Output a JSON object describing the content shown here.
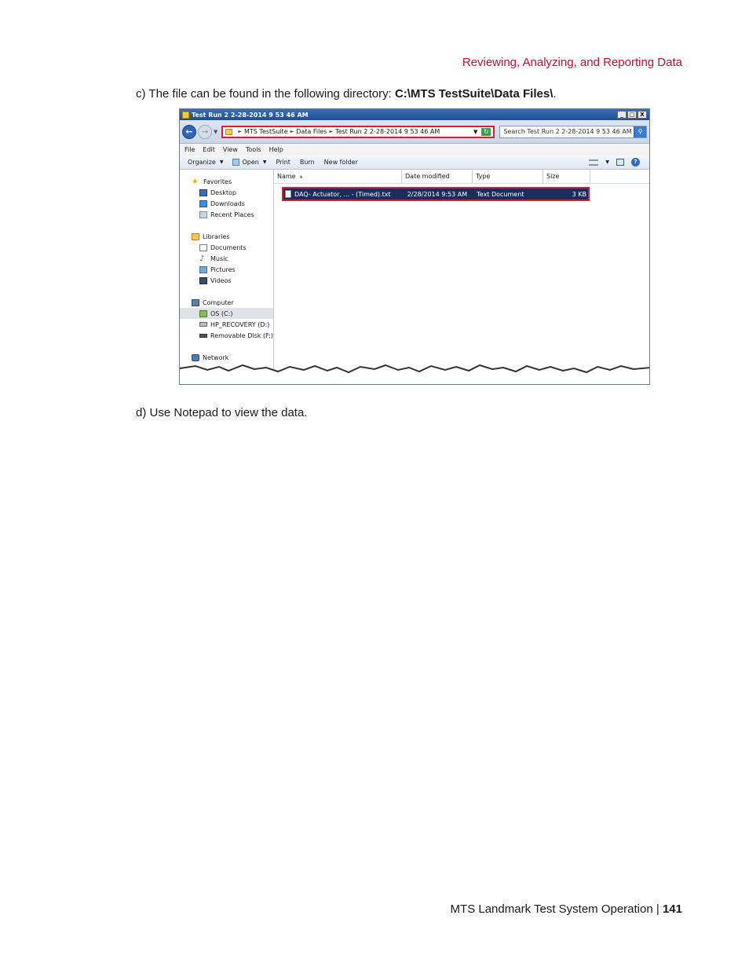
{
  "page_header": "Reviewing, Analyzing, and Reporting Data",
  "step_c": {
    "marker": "c)",
    "text": "The file can be found in the following directory:",
    "path": "C:\\MTS TestSuite\\Data Files\\",
    "end": "."
  },
  "step_d": {
    "marker": "d)",
    "text": "Use Notepad to view the data."
  },
  "footer": {
    "title": "MTS Landmark Test System Operation",
    "separator": "|",
    "page_number": "141"
  },
  "explorer": {
    "window_title": "Test Run 2 2-28-2014 9 53 46 AM",
    "window_buttons": [
      "_",
      "□",
      "X"
    ],
    "breadcrumbs": [
      "MTS TestSuite",
      "Data Files",
      "Test Run 2 2-28-2014 9 53 46 AM"
    ],
    "search_placeholder": "Search Test Run 2 2-28-2014 9 53 46 AM",
    "menu": [
      "File",
      "Edit",
      "View",
      "Tools",
      "Help"
    ],
    "commands": {
      "organize": "Organize",
      "open": "Open",
      "print": "Print",
      "burn": "Burn",
      "new_folder": "New folder"
    },
    "nav_pane": {
      "favorites": {
        "label": "Favorites",
        "items": [
          "Desktop",
          "Downloads",
          "Recent Places"
        ]
      },
      "libraries": {
        "label": "Libraries",
        "items": [
          "Documents",
          "Music",
          "Pictures",
          "Videos"
        ]
      },
      "computer": {
        "label": "Computer",
        "items": [
          "OS (C:)",
          "HP_RECOVERY (D:)",
          "Removable Disk (F:)"
        ]
      },
      "network": {
        "label": "Network"
      }
    },
    "columns": [
      "Name",
      "Date modified",
      "Type",
      "Size"
    ],
    "files": [
      {
        "name": "DAQ- Actuator, ... - (Timed).txt",
        "date_modified": "2/28/2014 9:53 AM",
        "type": "Text Document",
        "size": "3 KB"
      }
    ],
    "colors": {
      "highlight_border": "#d6202f",
      "selected_row": "#1a2e5a",
      "title_bar": "#1f4d95"
    }
  }
}
